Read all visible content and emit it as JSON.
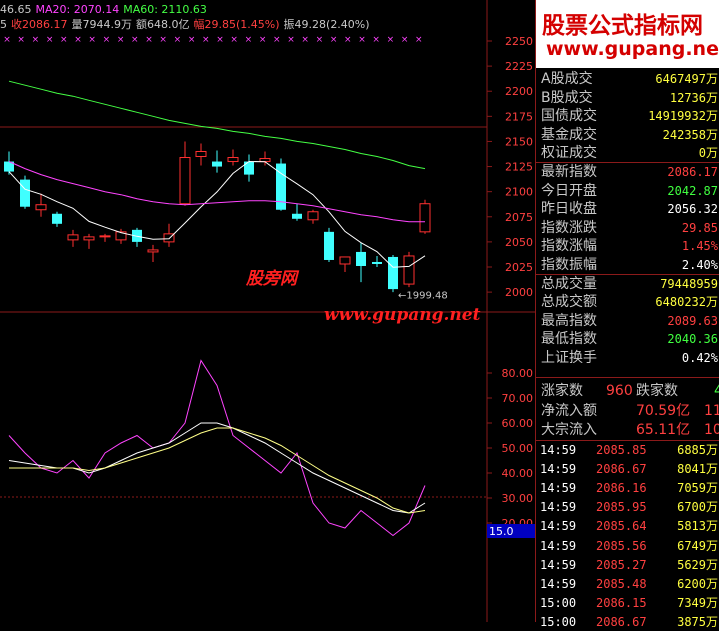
{
  "header": {
    "line1": [
      {
        "text": "46.65",
        "color": "#c8c8c8"
      },
      {
        "text": "MA20: 2070.14",
        "color": "#ff44ff"
      },
      {
        "text": "MA60: 2110.63",
        "color": "#44ff44"
      }
    ],
    "line2": [
      {
        "text": "5",
        "color": "#c8c8c8"
      },
      {
        "text": "收2086.17",
        "color": "#ff4040"
      },
      {
        "text": "量7944.9万",
        "color": "#c8c8c8"
      },
      {
        "text": "额648.0亿",
        "color": "#c8c8c8"
      },
      {
        "text": "幅29.85(1.45%)",
        "color": "#ff4040"
      },
      {
        "text": "振49.28(2.40%)",
        "color": "#c8c8c8"
      }
    ]
  },
  "watermark": {
    "cn": "股旁网",
    "url": "www.gupang.net"
  },
  "low_marker": "←1999.48",
  "price_axis": [
    "2250",
    "2225",
    "2200",
    "2175",
    "2150",
    "2125",
    "2100",
    "2075",
    "2050",
    "2025",
    "2000"
  ],
  "ind_axis": [
    "80.00",
    "70.00",
    "60.00",
    "50.00",
    "40.00",
    "30.00",
    "20.00"
  ],
  "ind_marker": "15.0",
  "colors": {
    "up": "#ff3030",
    "down": "#40ffff",
    "ma5": "#ffffff",
    "ma20": "#ff44ff",
    "ma60": "#44ff44",
    "grid": "#8b1a1a"
  },
  "chart_data": [
    {
      "type": "candlestick",
      "title": "",
      "ylim": [
        1990,
        2260
      ],
      "ohlc": [
        [
          2130,
          2140,
          2117,
          2120
        ],
        [
          2112,
          2116,
          2083,
          2085
        ],
        [
          2082,
          2098,
          2075,
          2087
        ],
        [
          2078,
          2080,
          2065,
          2068
        ],
        [
          2052,
          2062,
          2045,
          2057
        ],
        [
          2052,
          2058,
          2043,
          2055
        ],
        [
          2055,
          2058,
          2050,
          2056
        ],
        [
          2052,
          2063,
          2048,
          2060
        ],
        [
          2062,
          2064,
          2045,
          2050
        ],
        [
          2040,
          2047,
          2030,
          2042
        ],
        [
          2050,
          2068,
          2045,
          2058
        ],
        [
          2088,
          2150,
          2086,
          2134
        ],
        [
          2135,
          2148,
          2126,
          2140
        ],
        [
          2130,
          2141,
          2119,
          2125
        ],
        [
          2130,
          2142,
          2126,
          2134
        ],
        [
          2130,
          2137,
          2110,
          2117
        ],
        [
          2130,
          2140,
          2126,
          2133
        ],
        [
          2128,
          2133,
          2081,
          2082
        ],
        [
          2078,
          2088,
          2071,
          2073
        ],
        [
          2072,
          2082,
          2068,
          2080
        ],
        [
          2060,
          2064,
          2030,
          2032
        ],
        [
          2028,
          2035,
          2020,
          2035
        ],
        [
          2040,
          2049,
          2010,
          2026
        ],
        [
          2030,
          2036,
          2025,
          2028
        ],
        [
          2035,
          2037,
          2000,
          2003
        ],
        [
          2008,
          2040,
          2005,
          2036
        ],
        [
          2060,
          2092,
          2058,
          2088
        ]
      ],
      "ma20": [
        2130,
        2123,
        2117,
        2112,
        2108,
        2104,
        2100,
        2097,
        2093,
        2090,
        2088,
        2087,
        2088,
        2089,
        2090,
        2091,
        2091,
        2090,
        2088,
        2086,
        2083,
        2080,
        2077,
        2075,
        2072,
        2070,
        2070
      ],
      "ma60": [
        2210,
        2206,
        2202,
        2198,
        2195,
        2191,
        2187,
        2183,
        2179,
        2175,
        2171,
        2168,
        2165,
        2163,
        2160,
        2158,
        2155,
        2153,
        2150,
        2148,
        2145,
        2142,
        2138,
        2135,
        2131,
        2126,
        2123
      ]
    },
    {
      "type": "line",
      "title": "",
      "ylim": [
        15,
        85
      ],
      "series": [
        {
          "values": [
            55,
            48,
            42,
            40,
            45,
            38,
            48,
            52,
            55,
            50,
            52,
            60,
            85,
            75,
            55,
            50,
            45,
            40,
            48,
            28,
            20,
            18,
            25,
            20,
            15,
            20,
            35
          ]
        },
        {
          "values": [
            45,
            44,
            43,
            42,
            42,
            40,
            42,
            45,
            48,
            50,
            52,
            56,
            60,
            60,
            58,
            55,
            52,
            48,
            44,
            40,
            37,
            34,
            31,
            28,
            25,
            24,
            28
          ]
        },
        {
          "values": [
            42,
            42,
            42,
            42,
            42,
            41,
            42,
            44,
            46,
            48,
            50,
            53,
            56,
            58,
            58,
            56,
            54,
            51,
            47,
            43,
            39,
            36,
            33,
            30,
            26,
            24,
            25
          ]
        }
      ]
    }
  ],
  "panel": {
    "logo_line1": "股票公式指标网",
    "logo_line2": "www.gupang.net",
    "quotes": [
      {
        "label": "A股成交",
        "value": "6467497万",
        "color": "#ffff40"
      },
      {
        "label": "B股成交",
        "value": "12736万",
        "color": "#ffff40"
      },
      {
        "label": "国债成交",
        "value": "14919932万",
        "color": "#ffff40"
      },
      {
        "label": "基金成交",
        "value": "242358万",
        "color": "#ffff40"
      },
      {
        "label": "权证成交",
        "value": "0万",
        "color": "#ffff40"
      },
      {
        "label": "最新指数",
        "value": "2086.17",
        "color": "#ff4040"
      },
      {
        "label": "今日开盘",
        "value": "2042.87",
        "color": "#40ff40"
      },
      {
        "label": "昨日收盘",
        "value": "2056.32",
        "color": "#ffffff"
      },
      {
        "label": "指数涨跌",
        "value": "29.85",
        "color": "#ff4040"
      },
      {
        "label": "指数涨幅",
        "value": "1.45%",
        "color": "#ff4040"
      },
      {
        "label": "指数振幅",
        "value": "2.40%",
        "color": "#ffffff"
      },
      {
        "label": "总成交量",
        "value": "79448959",
        "color": "#ffff40"
      },
      {
        "label": "总成交额",
        "value": "6480232万",
        "color": "#ffff40"
      },
      {
        "label": "最高指数",
        "value": "2089.63",
        "color": "#ff4040"
      },
      {
        "label": "最低指数",
        "value": "2040.36",
        "color": "#40ff40"
      },
      {
        "label": "上证换手",
        "value": "0.42%",
        "color": "#ffffff"
      }
    ],
    "breadth": {
      "up_label": "涨家数",
      "up_value": "960",
      "down_label": "跌家数",
      "down_value": "4"
    },
    "flows": [
      {
        "label": "净流入额",
        "value": "70.59亿",
        "extra": "11"
      },
      {
        "label": "大宗流入",
        "value": "65.11亿",
        "extra": "10"
      }
    ],
    "ticks": [
      {
        "time": "14:59",
        "price": "2085.85",
        "vol": "6885万"
      },
      {
        "time": "14:59",
        "price": "2086.67",
        "vol": "8041万"
      },
      {
        "time": "14:59",
        "price": "2086.16",
        "vol": "7059万"
      },
      {
        "time": "14:59",
        "price": "2085.95",
        "vol": "6700万"
      },
      {
        "time": "14:59",
        "price": "2085.64",
        "vol": "5813万"
      },
      {
        "time": "14:59",
        "price": "2085.56",
        "vol": "6749万"
      },
      {
        "time": "14:59",
        "price": "2085.27",
        "vol": "5629万"
      },
      {
        "time": "14:59",
        "price": "2085.48",
        "vol": "6200万"
      },
      {
        "time": "15:00",
        "price": "2086.15",
        "vol": "7349万"
      },
      {
        "time": "15:00",
        "price": "2086.67",
        "vol": "3875万"
      }
    ]
  }
}
